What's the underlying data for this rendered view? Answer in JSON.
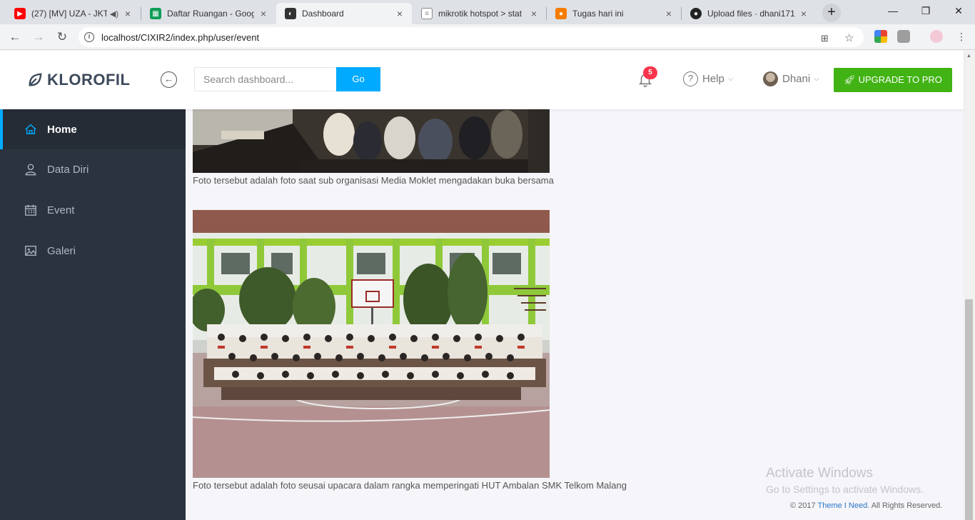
{
  "browser": {
    "tabs": [
      {
        "title": "(27) [MV] UZA - JKT",
        "icon": "youtube-icon",
        "color": "#ff0000",
        "active": false
      },
      {
        "title": "Daftar Ruangan - Goog",
        "icon": "sheets-icon",
        "color": "#0f9d58",
        "active": false
      },
      {
        "title": "Dashboard",
        "icon": "klorofil-icon",
        "color": "#333333",
        "active": true
      },
      {
        "title": "mikrotik hotspot > stat",
        "icon": "document-icon",
        "color": "#888888",
        "active": false
      },
      {
        "title": "Tugas hari ini",
        "icon": "classroom-icon",
        "color": "#f57c00",
        "active": false
      },
      {
        "title": "Upload files · dhani171",
        "icon": "github-icon",
        "color": "#222222",
        "active": false
      }
    ],
    "new_tab": "+",
    "window_controls": {
      "minimize": "—",
      "restore": "❐",
      "close": "✕"
    },
    "url": "localhost/CIXIR2/index.php/user/event"
  },
  "header": {
    "brand": "KLOROFIL",
    "search_placeholder": "Search dashboard...",
    "search_button": "Go",
    "notification_count": "5",
    "help_label": "Help",
    "user_name": "Dhani",
    "upgrade_label": "UPGRADE TO PRO",
    "accent": "#00aaff",
    "upgrade_color": "#41b314"
  },
  "sidebar": {
    "items": [
      {
        "label": "Home",
        "icon": "home-icon",
        "active": true
      },
      {
        "label": "Data Diri",
        "icon": "user-icon",
        "active": false
      },
      {
        "label": "Event",
        "icon": "calendar-icon",
        "active": false
      },
      {
        "label": "Galeri",
        "icon": "image-icon",
        "active": false
      }
    ]
  },
  "content": {
    "posts": [
      {
        "caption": "Foto tersebut adalah foto saat sub organisasi Media Moklet mengadakan buka bersama"
      },
      {
        "caption": "Foto tersebut adalah foto seusai upacara dalam rangka memperingati HUT Ambalan SMK Telkom Malang"
      }
    ]
  },
  "watermark": {
    "title": "Activate Windows",
    "subtitle": "Go to Settings to activate Windows."
  },
  "footer": {
    "prefix": "© 2017 ",
    "link": "Theme I Need",
    "suffix": ". All Rights Reserved."
  }
}
